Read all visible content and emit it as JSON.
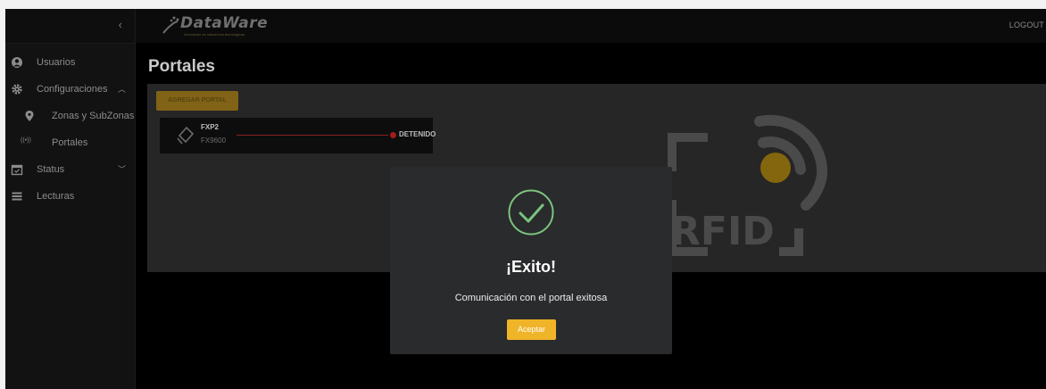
{
  "sidebar": {
    "collapse_icon": "chevron-left-icon",
    "items": [
      {
        "label": "Usuarios",
        "icon": "user-circle-icon"
      },
      {
        "label": "Configuraciones",
        "icon": "gear-icon",
        "arrow": "^"
      },
      {
        "label": "Zonas y SubZonas",
        "icon": "map-pin-icon"
      },
      {
        "label": "Portales",
        "icon": "wifi-signal-icon"
      },
      {
        "label": "Status",
        "icon": "calendar-icon",
        "arrow": "v"
      },
      {
        "label": "Lecturas",
        "icon": "list-icon"
      }
    ]
  },
  "topbar": {
    "logo_text": "DataWare",
    "logo_tagline": "Innovación en soluciones tecnológicas",
    "logout_label": "LOGOUT"
  },
  "main": {
    "title": "Portales",
    "add_button_label": "AGREGAR PORTAL",
    "portal": {
      "name": "FXP2",
      "model": "FX9600",
      "status": "DETENIDO",
      "status_color": "#a01c1c"
    }
  },
  "modal": {
    "title": "¡Exito!",
    "message": "Comunicación con el portal exitosa",
    "button_label": "Aceptar"
  },
  "colors": {
    "accent": "#f0b429",
    "success": "#7bc47f"
  }
}
